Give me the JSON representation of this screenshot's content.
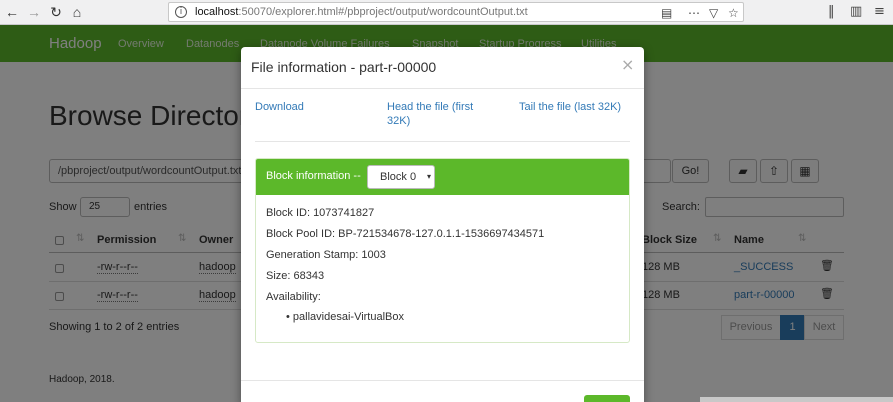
{
  "browser": {
    "url_host": "localhost",
    "url_rest": ":50070/explorer.html#/pbproject/output/wordcountOutput.txt",
    "icons": [
      "back-icon",
      "forward-icon",
      "reload-icon",
      "home-icon",
      "info-icon",
      "reader-view-icon",
      "more-icon",
      "pocket-icon",
      "bookmark-star-icon",
      "library-icon",
      "sidebar-icon",
      "menu-icon"
    ]
  },
  "navbar": {
    "brand": "Hadoop",
    "items": [
      "Overview",
      "Datanodes",
      "Datanode Volume Failures",
      "Snapshot",
      "Startup Progress",
      "Utilities"
    ]
  },
  "page": {
    "title": "Browse Directory",
    "path_value": "/pbproject/output/wordcountOutput.txt",
    "go_label": "Go!",
    "show_label": "Show",
    "entries_value": "25",
    "entries_label": "entries",
    "search_label": "Search:",
    "columns": [
      "Permission",
      "Owner",
      "Block Size",
      "Name"
    ],
    "rows": [
      {
        "permission": "-rw-r--r--",
        "owner": "hadoop",
        "block_size": "128 MB",
        "name": "_SUCCESS"
      },
      {
        "permission": "-rw-r--r--",
        "owner": "hadoop",
        "block_size": "128 MB",
        "name": "part-r-00000"
      }
    ],
    "info": "Showing 1 to 2 of 2 entries",
    "pager": {
      "previous": "Previous",
      "current": "1",
      "next": "Next"
    },
    "footer": "Hadoop, 2018."
  },
  "modal": {
    "title": "File information - part-r-00000",
    "close": "×",
    "download": "Download",
    "head": "Head the file (first 32K)",
    "tail": "Tail the file (last 32K)",
    "block_info_label": "Block information --",
    "block_select": "Block 0",
    "block_id": "Block ID: 1073741827",
    "block_pool": "Block Pool ID: BP-721534678-127.0.1.1-1536697434571",
    "generation_stamp": "Generation Stamp: 1003",
    "size": "Size: 68343",
    "availability_label": "Availability:",
    "availability": [
      "pallavidesai-VirtualBox"
    ]
  }
}
